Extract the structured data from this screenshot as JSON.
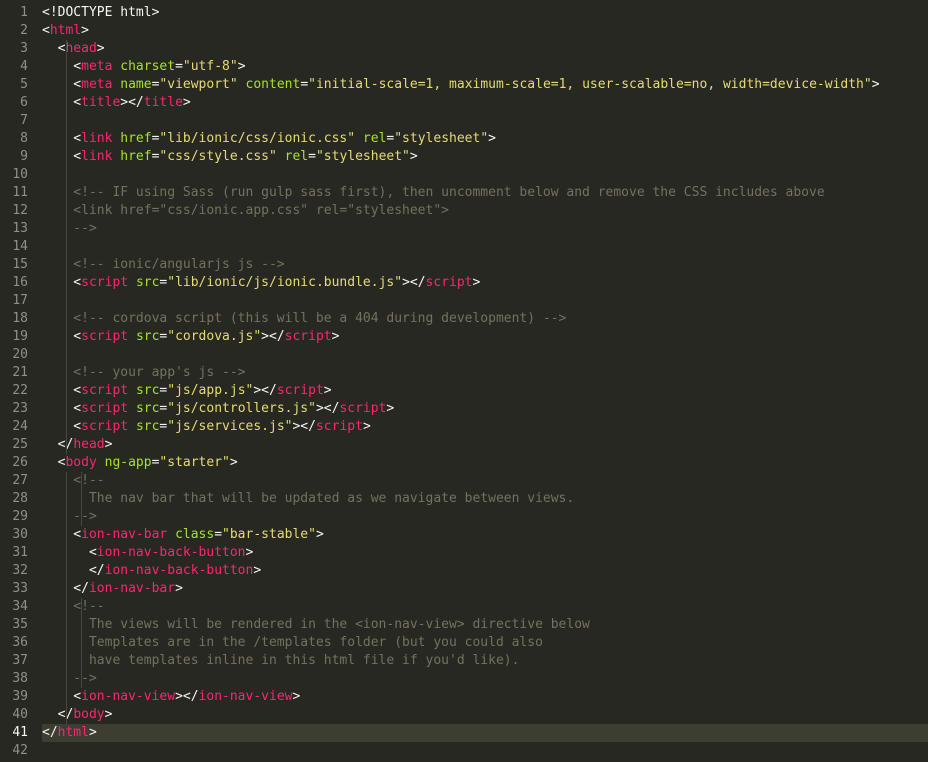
{
  "editor": {
    "theme": {
      "background": "#272822",
      "current_line": "#3e3d32",
      "tag": "#f92672",
      "attribute": "#a6e22e",
      "string": "#e6db74",
      "comment": "#75715e",
      "text": "#f8f8f2",
      "gutter_text": "#8f908a"
    },
    "current_line": 41,
    "lines": [
      [
        {
          "t": "<!DOCTYPE html>",
          "c": "text"
        }
      ],
      [
        {
          "t": "<",
          "c": "text"
        },
        {
          "t": "html",
          "c": "tag"
        },
        {
          "t": ">",
          "c": "text"
        }
      ],
      [
        {
          "t": "  <",
          "c": "text"
        },
        {
          "t": "head",
          "c": "tag"
        },
        {
          "t": ">",
          "c": "text"
        }
      ],
      [
        {
          "t": "    <",
          "c": "text"
        },
        {
          "t": "meta",
          "c": "tag"
        },
        {
          "t": " ",
          "c": "text"
        },
        {
          "t": "charset",
          "c": "attr"
        },
        {
          "t": "=",
          "c": "text"
        },
        {
          "t": "\"utf-8\"",
          "c": "str"
        },
        {
          "t": ">",
          "c": "text"
        }
      ],
      [
        {
          "t": "    <",
          "c": "text"
        },
        {
          "t": "meta",
          "c": "tag"
        },
        {
          "t": " ",
          "c": "text"
        },
        {
          "t": "name",
          "c": "attr"
        },
        {
          "t": "=",
          "c": "text"
        },
        {
          "t": "\"viewport\"",
          "c": "str"
        },
        {
          "t": " ",
          "c": "text"
        },
        {
          "t": "content",
          "c": "attr"
        },
        {
          "t": "=",
          "c": "text"
        },
        {
          "t": "\"initial-scale=1, maximum-scale=1, user-scalable=no, width=device-width\"",
          "c": "str"
        },
        {
          "t": ">",
          "c": "text"
        }
      ],
      [
        {
          "t": "    <",
          "c": "text"
        },
        {
          "t": "title",
          "c": "tag"
        },
        {
          "t": "></",
          "c": "text"
        },
        {
          "t": "title",
          "c": "tag"
        },
        {
          "t": ">",
          "c": "text"
        }
      ],
      [],
      [
        {
          "t": "    <",
          "c": "text"
        },
        {
          "t": "link",
          "c": "tag"
        },
        {
          "t": " ",
          "c": "text"
        },
        {
          "t": "href",
          "c": "attr"
        },
        {
          "t": "=",
          "c": "text"
        },
        {
          "t": "\"lib/ionic/css/ionic.css\"",
          "c": "str"
        },
        {
          "t": " ",
          "c": "text"
        },
        {
          "t": "rel",
          "c": "attr"
        },
        {
          "t": "=",
          "c": "text"
        },
        {
          "t": "\"stylesheet\"",
          "c": "str"
        },
        {
          "t": ">",
          "c": "text"
        }
      ],
      [
        {
          "t": "    <",
          "c": "text"
        },
        {
          "t": "link",
          "c": "tag"
        },
        {
          "t": " ",
          "c": "text"
        },
        {
          "t": "href",
          "c": "attr"
        },
        {
          "t": "=",
          "c": "text"
        },
        {
          "t": "\"css/style.css\"",
          "c": "str"
        },
        {
          "t": " ",
          "c": "text"
        },
        {
          "t": "rel",
          "c": "attr"
        },
        {
          "t": "=",
          "c": "text"
        },
        {
          "t": "\"stylesheet\"",
          "c": "str"
        },
        {
          "t": ">",
          "c": "text"
        }
      ],
      [],
      [
        {
          "t": "    <!-- IF using Sass (run gulp sass first), then uncomment below and remove the CSS includes above",
          "c": "com"
        }
      ],
      [
        {
          "t": "    <link href=\"css/ionic.app.css\" rel=\"stylesheet\">",
          "c": "com"
        }
      ],
      [
        {
          "t": "    -->",
          "c": "com"
        }
      ],
      [],
      [
        {
          "t": "    <!-- ionic/angularjs js -->",
          "c": "com"
        }
      ],
      [
        {
          "t": "    <",
          "c": "text"
        },
        {
          "t": "script",
          "c": "tag"
        },
        {
          "t": " ",
          "c": "text"
        },
        {
          "t": "src",
          "c": "attr"
        },
        {
          "t": "=",
          "c": "text"
        },
        {
          "t": "\"lib/ionic/js/ionic.bundle.js\"",
          "c": "str"
        },
        {
          "t": "></",
          "c": "text"
        },
        {
          "t": "script",
          "c": "tag"
        },
        {
          "t": ">",
          "c": "text"
        }
      ],
      [],
      [
        {
          "t": "    <!-- cordova script (this will be a 404 during development) -->",
          "c": "com"
        }
      ],
      [
        {
          "t": "    <",
          "c": "text"
        },
        {
          "t": "script",
          "c": "tag"
        },
        {
          "t": " ",
          "c": "text"
        },
        {
          "t": "src",
          "c": "attr"
        },
        {
          "t": "=",
          "c": "text"
        },
        {
          "t": "\"cordova.js\"",
          "c": "str"
        },
        {
          "t": "></",
          "c": "text"
        },
        {
          "t": "script",
          "c": "tag"
        },
        {
          "t": ">",
          "c": "text"
        }
      ],
      [],
      [
        {
          "t": "    <!-- your app's js -->",
          "c": "com"
        }
      ],
      [
        {
          "t": "    <",
          "c": "text"
        },
        {
          "t": "script",
          "c": "tag"
        },
        {
          "t": " ",
          "c": "text"
        },
        {
          "t": "src",
          "c": "attr"
        },
        {
          "t": "=",
          "c": "text"
        },
        {
          "t": "\"js/app.js\"",
          "c": "str"
        },
        {
          "t": "></",
          "c": "text"
        },
        {
          "t": "script",
          "c": "tag"
        },
        {
          "t": ">",
          "c": "text"
        }
      ],
      [
        {
          "t": "    <",
          "c": "text"
        },
        {
          "t": "script",
          "c": "tag"
        },
        {
          "t": " ",
          "c": "text"
        },
        {
          "t": "src",
          "c": "attr"
        },
        {
          "t": "=",
          "c": "text"
        },
        {
          "t": "\"js/controllers.js\"",
          "c": "str"
        },
        {
          "t": "></",
          "c": "text"
        },
        {
          "t": "script",
          "c": "tag"
        },
        {
          "t": ">",
          "c": "text"
        }
      ],
      [
        {
          "t": "    <",
          "c": "text"
        },
        {
          "t": "script",
          "c": "tag"
        },
        {
          "t": " ",
          "c": "text"
        },
        {
          "t": "src",
          "c": "attr"
        },
        {
          "t": "=",
          "c": "text"
        },
        {
          "t": "\"js/services.js\"",
          "c": "str"
        },
        {
          "t": "></",
          "c": "text"
        },
        {
          "t": "script",
          "c": "tag"
        },
        {
          "t": ">",
          "c": "text"
        }
      ],
      [
        {
          "t": "  </",
          "c": "text"
        },
        {
          "t": "head",
          "c": "tag"
        },
        {
          "t": ">",
          "c": "text"
        }
      ],
      [
        {
          "t": "  <",
          "c": "text"
        },
        {
          "t": "body",
          "c": "tag"
        },
        {
          "t": " ",
          "c": "text"
        },
        {
          "t": "ng-app",
          "c": "attr"
        },
        {
          "t": "=",
          "c": "text"
        },
        {
          "t": "\"starter\"",
          "c": "str"
        },
        {
          "t": ">",
          "c": "text"
        }
      ],
      [
        {
          "t": "    <!--",
          "c": "com"
        }
      ],
      [
        {
          "t": "      The nav bar that will be updated as we navigate between views.",
          "c": "com"
        }
      ],
      [
        {
          "t": "    -->",
          "c": "com"
        }
      ],
      [
        {
          "t": "    <",
          "c": "text"
        },
        {
          "t": "ion-nav-bar",
          "c": "tag"
        },
        {
          "t": " ",
          "c": "text"
        },
        {
          "t": "class",
          "c": "attr"
        },
        {
          "t": "=",
          "c": "text"
        },
        {
          "t": "\"bar-stable\"",
          "c": "str"
        },
        {
          "t": ">",
          "c": "text"
        }
      ],
      [
        {
          "t": "      <",
          "c": "text"
        },
        {
          "t": "ion-nav-back-button",
          "c": "tag"
        },
        {
          "t": ">",
          "c": "text"
        }
      ],
      [
        {
          "t": "      </",
          "c": "text"
        },
        {
          "t": "ion-nav-back-button",
          "c": "tag"
        },
        {
          "t": ">",
          "c": "text"
        }
      ],
      [
        {
          "t": "    </",
          "c": "text"
        },
        {
          "t": "ion-nav-bar",
          "c": "tag"
        },
        {
          "t": ">",
          "c": "text"
        }
      ],
      [
        {
          "t": "    <!--",
          "c": "com"
        }
      ],
      [
        {
          "t": "      The views will be rendered in the <ion-nav-view> directive below",
          "c": "com"
        }
      ],
      [
        {
          "t": "      Templates are in the /templates folder (but you could also",
          "c": "com"
        }
      ],
      [
        {
          "t": "      have templates inline in this html file if you'd like).",
          "c": "com"
        }
      ],
      [
        {
          "t": "    -->",
          "c": "com"
        }
      ],
      [
        {
          "t": "    <",
          "c": "text"
        },
        {
          "t": "ion-nav-view",
          "c": "tag"
        },
        {
          "t": "></",
          "c": "text"
        },
        {
          "t": "ion-nav-view",
          "c": "tag"
        },
        {
          "t": ">",
          "c": "text"
        }
      ],
      [
        {
          "t": "  </",
          "c": "text"
        },
        {
          "t": "body",
          "c": "tag"
        },
        {
          "t": ">",
          "c": "text"
        }
      ],
      [
        {
          "t": "</",
          "c": "text"
        },
        {
          "t": "html",
          "c": "tag"
        },
        {
          "t": ">",
          "c": "text"
        }
      ],
      []
    ]
  }
}
